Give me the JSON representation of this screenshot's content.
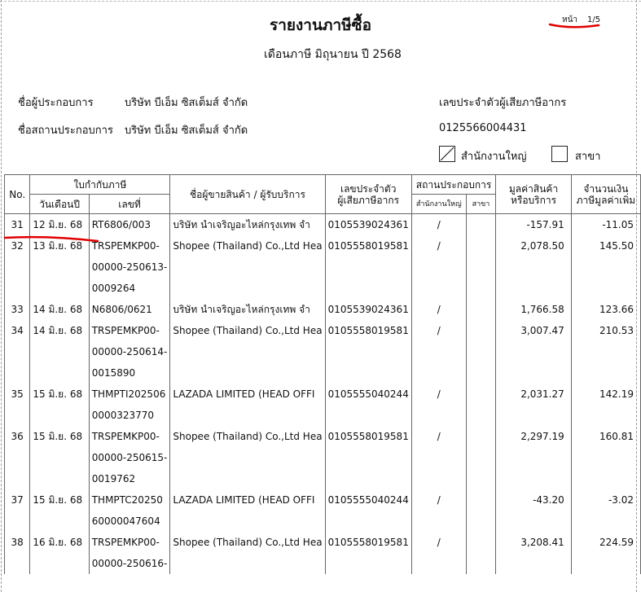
{
  "report": {
    "title": "รายงานภาษีซื้อ",
    "subtitle": "เดือนภาษี มิถุนายน ปี 2568",
    "page_label": "หน้า",
    "page_value": "1/5"
  },
  "company": {
    "operator_label": "ชื่อผู้ประกอบการ",
    "operator_value": "บริษัท บีเอ็ม ซิสเต็มส์ จำกัด",
    "establishment_label": "ชื่อสถานประกอบการ",
    "establishment_value": "บริษัท บีเอ็ม ซิสเต็มส์ จำกัด",
    "tax_id_label": "เลขประจำตัวผู้เสียภาษีอากร",
    "tax_id_value": "0125566004431",
    "head_office_label": "สำนักงานใหญ่",
    "branch_label": "สาขา",
    "head_office_checked": true,
    "branch_checked": false
  },
  "table": {
    "headers": {
      "no": "No.",
      "invoice_group": "ใบกำกับภาษี",
      "date": "วันเดือนปี",
      "number": "เลขที่",
      "seller": "ชื่อผู้ขายสินค้า / ผู้รับบริการ",
      "tax_id_line1": "เลขประจำตัว",
      "tax_id_line2": "ผู้เสียภาษีอากร",
      "establishment": "สถานประกอบการ",
      "head_office": "สำนักงานใหญ่",
      "branch": "สาขา",
      "value_line1": "มูลค่าสินค้า",
      "value_line2": "หรือบริการ",
      "vat_line1": "จำนวนเงิน",
      "vat_line2": "ภาษีมูลค่าเพิ่ม"
    },
    "rows": [
      {
        "no": "31",
        "date": "12 มิ.ย. 68",
        "number": [
          "RT6806/003"
        ],
        "seller": "บริษัท นำเจริญอะไหล่กรุงเทพ จำ",
        "tax_id": "0105539024361",
        "head_office": "/",
        "branch": "",
        "value": "-157.91",
        "vat": "-11.05"
      },
      {
        "no": "32",
        "date": "13 มิ.ย. 68",
        "number": [
          "TRSPEMKP00-",
          "00000-250613-",
          "0009264"
        ],
        "seller": "Shopee (Thailand) Co.,Ltd Hea",
        "tax_id": "0105558019581",
        "head_office": "/",
        "branch": "",
        "value": "2,078.50",
        "vat": "145.50"
      },
      {
        "no": "33",
        "date": "14 มิ.ย. 68",
        "number": [
          "N6806/0621"
        ],
        "seller": "บริษัท นำเจริญอะไหล่กรุงเทพ จำ",
        "tax_id": "0105539024361",
        "head_office": "/",
        "branch": "",
        "value": "1,766.58",
        "vat": "123.66"
      },
      {
        "no": "34",
        "date": "14 มิ.ย. 68",
        "number": [
          "TRSPEMKP00-",
          "00000-250614-",
          "0015890"
        ],
        "seller": "Shopee (Thailand) Co.,Ltd Hea",
        "tax_id": "0105558019581",
        "head_office": "/",
        "branch": "",
        "value": "3,007.47",
        "vat": "210.53"
      },
      {
        "no": "35",
        "date": "15 มิ.ย. 68",
        "number": [
          "THMPTI202506",
          "0000323770"
        ],
        "seller": "LAZADA  LIMITED  (HEAD OFFI",
        "tax_id": "0105555040244",
        "head_office": "/",
        "branch": "",
        "value": "2,031.27",
        "vat": "142.19"
      },
      {
        "no": "36",
        "date": "15 มิ.ย. 68",
        "number": [
          "TRSPEMKP00-",
          "00000-250615-",
          "0019762"
        ],
        "seller": "Shopee (Thailand) Co.,Ltd Hea",
        "tax_id": "0105558019581",
        "head_office": "/",
        "branch": "",
        "value": "2,297.19",
        "vat": "160.81"
      },
      {
        "no": "37",
        "date": "15 มิ.ย. 68",
        "number": [
          "THMPTC20250",
          "60000047604"
        ],
        "seller": "LAZADA  LIMITED  (HEAD OFFI",
        "tax_id": "0105555040244",
        "head_office": "/",
        "branch": "",
        "value": "-43.20",
        "vat": "-3.02"
      },
      {
        "no": "38",
        "date": "16 มิ.ย. 68",
        "number": [
          "TRSPEMKP00-",
          "00000-250616-"
        ],
        "seller": "Shopee (Thailand) Co.,Ltd Hea",
        "tax_id": "0105558019581",
        "head_office": "/",
        "branch": "",
        "value": "3,208.41",
        "vat": "224.59"
      }
    ]
  },
  "colors": {
    "annotation": "#e00000",
    "grid": "#666666"
  }
}
